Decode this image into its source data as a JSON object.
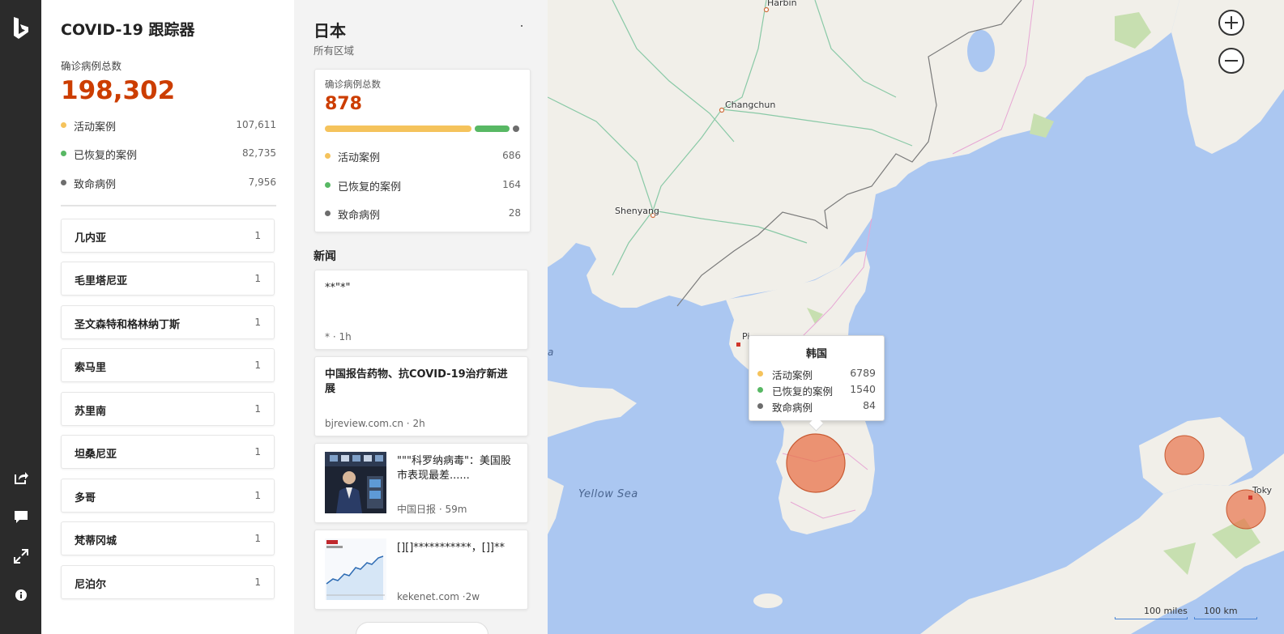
{
  "colors": {
    "accent_total": "#cc3d00",
    "active": "#f5c35c",
    "recovered": "#58b864",
    "deaths": "#6d6d6d",
    "bubble": "#e8734a",
    "water": "#abc7f1",
    "land": "#f1efe9"
  },
  "rail": {
    "icons": [
      "bing-logo",
      "share-icon",
      "feedback-icon",
      "expand-icon",
      "info-icon"
    ]
  },
  "tracker": {
    "title": "COVID-19 跟踪器",
    "total_label": "确诊病例总数",
    "total_value": "198,302",
    "stats": [
      {
        "label": "活动案例",
        "value": "107,611"
      },
      {
        "label": "已恢复的案例",
        "value": "82,735"
      },
      {
        "label": "致命病例",
        "value": "7,956"
      }
    ],
    "countries": [
      {
        "name": "几内亚",
        "count": "1"
      },
      {
        "name": "毛里塔尼亚",
        "count": "1"
      },
      {
        "name": "圣文森特和格林纳丁斯",
        "count": "1"
      },
      {
        "name": "索马里",
        "count": "1"
      },
      {
        "name": "苏里南",
        "count": "1"
      },
      {
        "name": "坦桑尼亚",
        "count": "1"
      },
      {
        "name": "多哥",
        "count": "1"
      },
      {
        "name": "梵蒂冈城",
        "count": "1"
      },
      {
        "name": "尼泊尔",
        "count": "1"
      }
    ]
  },
  "region": {
    "title": "日本",
    "subtitle": "所有区域",
    "menu_dot": "·",
    "card": {
      "total_label": "确诊病例总数",
      "total_value": "878",
      "progress": {
        "active": 686,
        "recovered": 164,
        "deaths": 28
      },
      "stats": [
        {
          "label": "活动案例",
          "value": "686"
        },
        {
          "label": "已恢复的案例",
          "value": "164"
        },
        {
          "label": "致命病例",
          "value": "28"
        }
      ]
    },
    "news_title": "新闻",
    "news": [
      {
        "headline": "**\"*\"",
        "source": "*  · 1h",
        "bold": false,
        "thumb": ""
      },
      {
        "headline": "中国报告药物、抗COVID-19治疗新进展",
        "source": "bjreview.com.cn   · 2h",
        "bold": true,
        "thumb": ""
      },
      {
        "headline": "\"\"\"科罗纳病毒\"：美国股市表现最差......",
        "source": "中国日报   · 59m",
        "bold": false,
        "thumb": "trader-photo"
      },
      {
        "headline": "[][]***********，[]]**",
        "source": "kekenet.com  ·2w",
        "bold": false,
        "thumb": "sp500-chart"
      }
    ]
  },
  "map": {
    "cities": [
      {
        "name": "Harbin"
      },
      {
        "name": "Changchun"
      },
      {
        "name": "Shenyang"
      },
      {
        "name": "Pi"
      },
      {
        "name": "Toky"
      }
    ],
    "sea_label": "Yellow Sea",
    "edge_label": "a",
    "zoom_in": "+",
    "zoom_out": "−",
    "tooltip": {
      "title": "韩国",
      "rows": [
        {
          "label": "活动案例",
          "value": "6789"
        },
        {
          "label": "已恢复的案例",
          "value": "1540"
        },
        {
          "label": "致命病例",
          "value": "84"
        }
      ]
    },
    "scale": {
      "miles": "100 miles",
      "km": "100 km"
    }
  }
}
